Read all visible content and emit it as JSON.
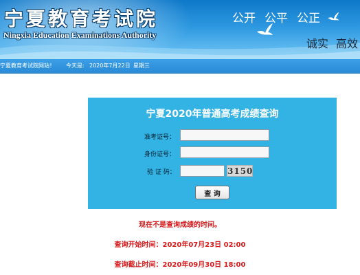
{
  "header": {
    "title": "宁夏教育考试院",
    "subtitle": "Ningxia Education Examinations Authority",
    "slogans": [
      "公开",
      "公平",
      "公正"
    ],
    "slogans2": [
      "诚实",
      "高效"
    ]
  },
  "statusbar": {
    "welcome": "宁夏教育考试院网站！",
    "date_prefix": "今天是:",
    "date": "2020年7月22日",
    "weekday": "星期三"
  },
  "query_form": {
    "title": "宁夏2020年普通高考成绩查询",
    "exam_number_label": "准考证号：",
    "exam_number_value": "",
    "id_number_label": "身份证号：",
    "id_number_value": "",
    "captcha_label": "验 证 码：",
    "captcha_value": "",
    "captcha_image_text": "3150",
    "submit_label": "查 询"
  },
  "notices": {
    "status": "现在不是查询成绩的时间。",
    "start_time": "查询开始时间：2020年07月23日 02:00",
    "end_time": "查询截止时间：2020年09月30日 18:00"
  },
  "colors": {
    "banner": "#2d98e0",
    "panel": "#33b2e4",
    "notice_red": "#d6191b"
  }
}
